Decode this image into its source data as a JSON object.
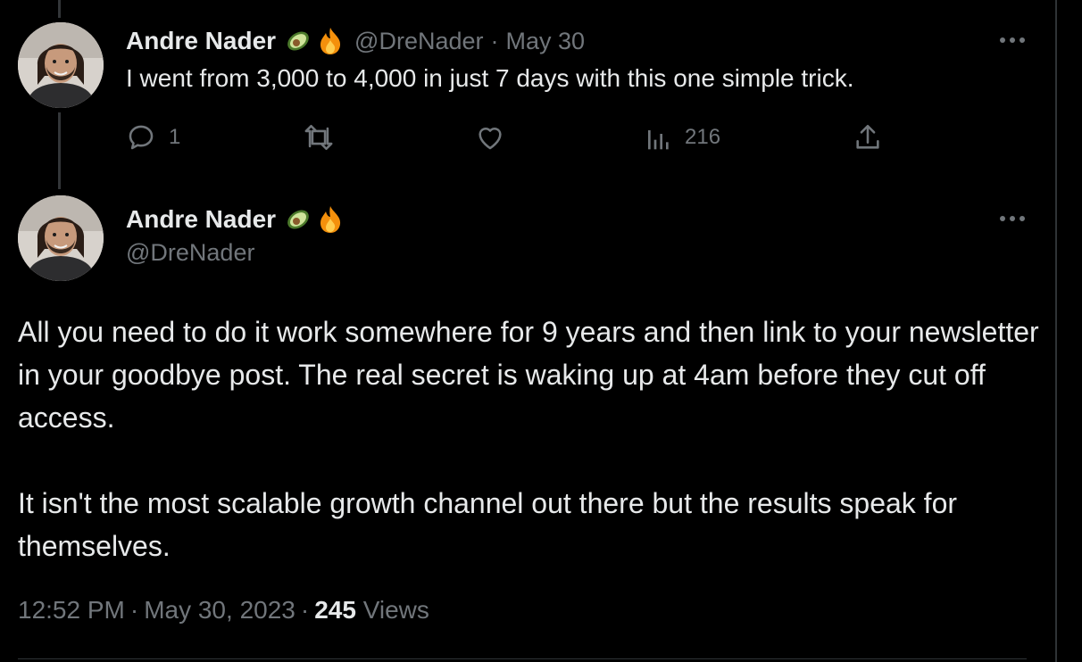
{
  "tweets": [
    {
      "display_name": "Andre Nader",
      "badges": [
        "avocado-emoji",
        "fire-emoji"
      ],
      "handle": "@DreNader",
      "separator": "·",
      "date": "May 30",
      "text": "I went from 3,000 to 4,000 in just 7 days with this one simple trick.",
      "actions": {
        "reply_count": "1",
        "retweet_count": "",
        "like_count": "",
        "views_count": "216"
      }
    },
    {
      "display_name": "Andre Nader",
      "badges": [
        "avocado-emoji",
        "fire-emoji"
      ],
      "handle": "@DreNader",
      "paragraphs": [
        "All you need to do it work somewhere for 9 years and then link to your newsletter in your goodbye post. The real secret is waking up at 4am before they cut off access.",
        "It isn't the most scalable growth channel out there but the results speak for themselves."
      ],
      "meta": {
        "time": "12:52 PM",
        "separator": "·",
        "date": "May 30, 2023",
        "views": "245",
        "views_label": "Views"
      }
    }
  ],
  "colors": {
    "background": "#000000",
    "primary_text": "#e7e9ea",
    "secondary_text": "#71767b",
    "divider": "#2f3336"
  }
}
